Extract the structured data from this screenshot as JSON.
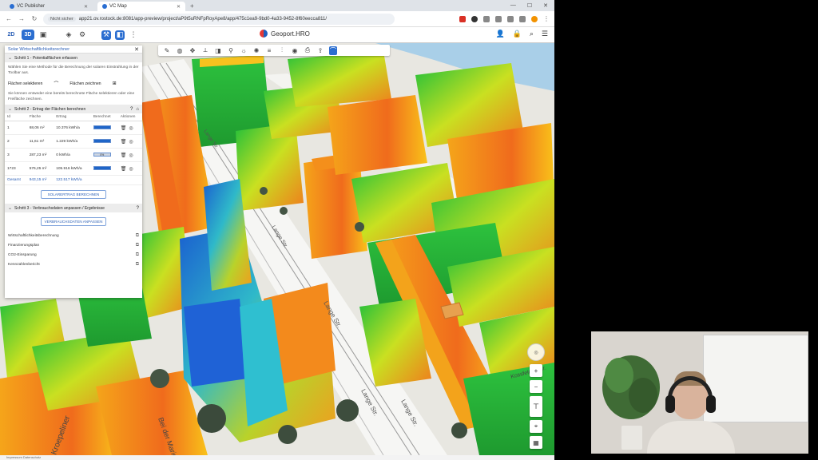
{
  "browser": {
    "tabs": [
      {
        "label": "VC Publisher",
        "active": false
      },
      {
        "label": "VC Map",
        "active": true
      }
    ],
    "address": {
      "security_label": "Nicht sicher",
      "url": "app21.ov.rostock.de:8081/app-preview/project/aP9t5uRNFpRoyApe8/app/475c1ea9-9bd0-4a33-9452-8f60eecca811/"
    }
  },
  "app": {
    "view_2d": "2D",
    "view_3d": "3D",
    "brand": "Geoport.HRO"
  },
  "panel": {
    "title": "Solar Wirtschaftlichkeitsrechner",
    "step1": {
      "title": "Schritt 1 - Potentialflächen erfassen",
      "intro": "Wählen Sie eine Methode für die Berechnung der solaren Einstrahlung in der Toolbar aus.",
      "option_select": "Flächen selektieren",
      "option_draw": "Flächen zeichnen",
      "hint": "Sie können entweder eine bereits berechnete Fläche selektieren oder eine Freifläche zeichnen."
    },
    "step2": {
      "title": "Schritt 2 - Ertrag der Flächen berechnen",
      "columns": [
        "Id",
        "Fläche",
        "Ertrag",
        "Berechnet",
        "Aktionen"
      ],
      "rows": [
        {
          "id": "1",
          "area": "68,06 m²",
          "yield": "10.376 kWh/a",
          "status": "100%",
          "filled": true
        },
        {
          "id": "2",
          "area": "11,61 m²",
          "yield": "1.229 kWh/a",
          "status": "100%",
          "filled": true
        },
        {
          "id": "3",
          "area": "287,23 m²",
          "yield": "0 kWh/a",
          "status": "0%",
          "filled": false
        },
        {
          "id": "1723",
          "area": "576,25 m²",
          "yield": "105.916 kWh/a",
          "status": "100%",
          "filled": true
        }
      ],
      "total_label": "Gesamt",
      "total_area": "943,15 m²",
      "total_yield": "122.517 kWh/a",
      "button": "SOLARERTRAG BERECHNEN"
    },
    "step3": {
      "title": "Schritt 3 - Verbrauchsdaten anpassen / Ergebnisse",
      "button": "VERBRAUCHSDATEN ANPASSEN",
      "links": [
        "Wirtschaftlichkeitsberechnung",
        "Finanzierungsplan",
        "CO2-Einsparung",
        "Kennzahlenbericht"
      ]
    }
  },
  "map": {
    "street_labels": [
      "Lange Str.",
      "Lange Str.",
      "Lange Str.",
      "Lange Str.",
      "Lange Str.",
      "Kroepeliner",
      "Bei der Marienkirche",
      "Kossfelder Str."
    ]
  },
  "statusbar": {
    "text": "Impressum   Datenschutz"
  },
  "icons": {
    "layers": "layers-icon",
    "search": "search-icon",
    "menu": "menu-icon",
    "user": "user-icon"
  }
}
